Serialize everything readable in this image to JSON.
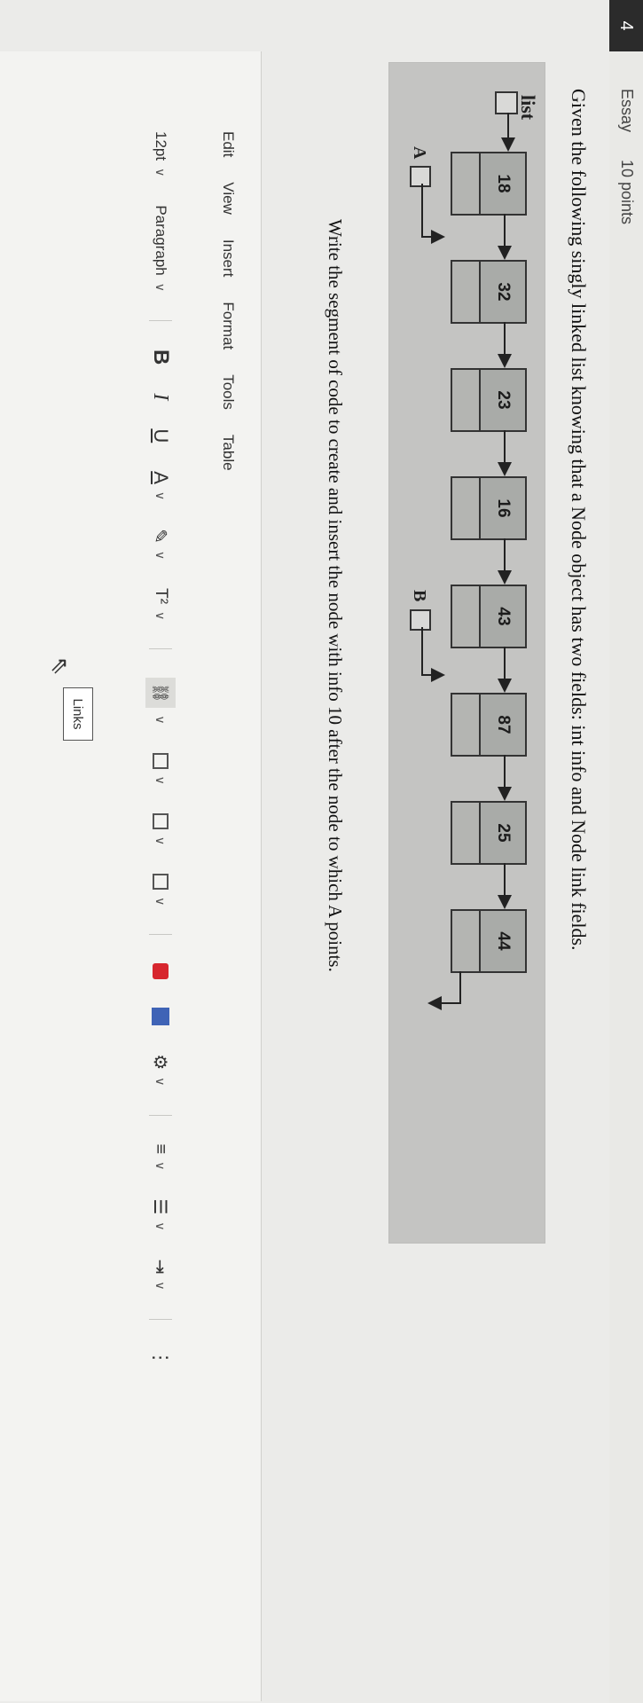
{
  "question": {
    "number": "4",
    "type": "Essay",
    "points": "10 points",
    "prompt": "Given the following singly linked list knowing that a Node object has two fields: int info and Node link fields.",
    "task": "Write the segment of code to create and insert the node with info 10 after the node to which A points."
  },
  "figure": {
    "list_label": "list",
    "nodes": [
      "18",
      "32",
      "23",
      "16",
      "43",
      "87",
      "25",
      "44"
    ],
    "pointer_a": "A",
    "pointer_b": "B"
  },
  "editor": {
    "menu": [
      "Edit",
      "View",
      "Insert",
      "Format",
      "Tools",
      "Table"
    ],
    "font_size": "12pt",
    "block_format": "Paragraph",
    "bold": "B",
    "italic": "I",
    "underline": "U",
    "text_color": "A",
    "superscript": "T²",
    "tooltip": "Links",
    "more": "⋮",
    "chevron": "∨"
  },
  "colors": {
    "header_badge": "#2b2b2b",
    "figure_bg": "#c4c4c2",
    "node_fill": "#a9aba8",
    "media_red": "#d7262e"
  }
}
